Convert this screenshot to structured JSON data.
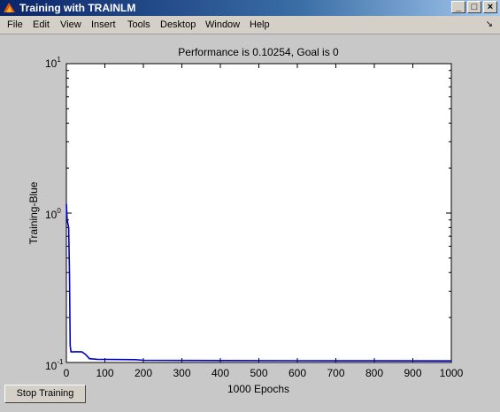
{
  "window": {
    "title": "Training with TRAINLM",
    "icon": "matlab-icon",
    "buttons": {
      "minimize": "_",
      "maximize": "□",
      "close": "×"
    }
  },
  "menubar": {
    "items": [
      "File",
      "Edit",
      "View",
      "Insert",
      "Tools",
      "Desktop",
      "Window",
      "Help"
    ],
    "dock_glyph": "↘"
  },
  "plot": {
    "title": "Performance is 0.10254, Goal is 0",
    "ylabel": "Training-Blue",
    "xlabel": "1000 Epochs",
    "ytick_base": "10",
    "ytick_exponents": [
      "1",
      "0",
      "-1"
    ]
  },
  "chart_data": {
    "type": "line",
    "title": "Performance is 0.10254, Goal is 0",
    "xlabel": "1000 Epochs",
    "ylabel": "Training-Blue",
    "yscale": "log",
    "xlim": [
      0,
      1000
    ],
    "ylim": [
      0.1,
      10
    ],
    "xticks": [
      0,
      100,
      200,
      300,
      400,
      500,
      600,
      700,
      800,
      900,
      1000
    ],
    "series": [
      {
        "color": "#0000cc",
        "x": [
          0,
          2,
          4,
          6,
          8,
          10,
          12,
          40,
          50,
          60,
          80,
          120,
          180,
          200,
          400,
          600,
          800,
          1000
        ],
        "y": [
          1.15,
          0.9,
          0.85,
          0.8,
          0.4,
          0.13,
          0.118,
          0.118,
          0.113,
          0.106,
          0.105,
          0.1048,
          0.1045,
          0.1035,
          0.103,
          0.1028,
          0.1026,
          0.10254
        ]
      }
    ]
  },
  "controls": {
    "stop_label": "Stop Training"
  }
}
